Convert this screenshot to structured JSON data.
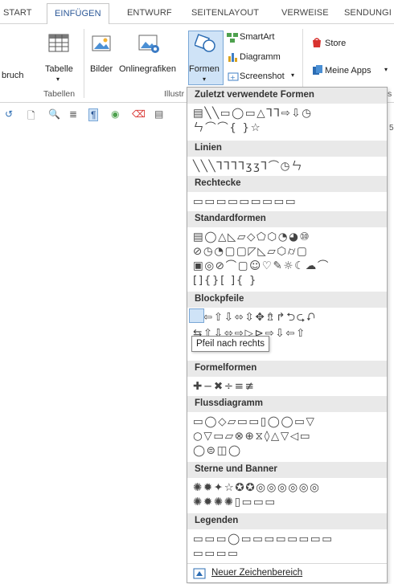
{
  "tabs": [
    "START",
    "EINFÜGEN",
    "ENTWURF",
    "SEITENLAYOUT",
    "VERWEISE",
    "SENDUNGI"
  ],
  "ribbon": {
    "umbruch_fragment": "bruch",
    "tabelle": "Tabelle",
    "bilder": "Bilder",
    "onlinegrafiken": "Onlinegrafiken",
    "formen": "Formen",
    "smartart": "SmartArt",
    "diagramm": "Diagramm",
    "screenshot": "Screenshot",
    "store": "Store",
    "meine_apps": "Meine Apps",
    "group_tabellen": "Tabellen",
    "group_illustrationen_fragment": "Illustr",
    "group_right_fragment": "s",
    "right_edge_fragment": "5"
  },
  "gallery": {
    "sections": [
      {
        "title": "Zuletzt verwendete Formen",
        "rows": [
          "▤╲╲▭◯▭△⅂⅂⇨⇩◷",
          "ㄣ⌒⌒{ }☆"
        ]
      },
      {
        "title": "Linien",
        "rows": [
          "╲╲╲⅂⅂⅂⅂ʒʒ⅂⌒◷ㄣ"
        ]
      },
      {
        "title": "Rechtecke",
        "rows": [
          "▭▭▭▭▭▭▭▭▭"
        ]
      },
      {
        "title": "Standardformen",
        "rows": [
          "▤◯△◺▱◇⬠⬡◔◕⑩",
          "⊘◷◔▢▢◸◺▱⬡⌭▢",
          "▣◎⊘⌒▢☺♡✎☼☾☁⌒",
          "[]{}[ ]{ }"
        ]
      },
      {
        "title": "Blockpfeile",
        "rows": [
          "⇨⇦⇧⇩⬄⇳✥⇯↱⮌⮎⮏",
          "⇆⇧⇩⬄⇨▷⊳⇨⇩⇦⇧"
        ]
      },
      {
        "title": "Formelformen",
        "rows": [
          "✚−✖÷≡≢"
        ]
      },
      {
        "title": "Flussdiagramm",
        "rows": [
          "▭◯◇▱▭▭▯◯◯▭▽",
          "○▽▭▱⊗⊕⧖◊△▽◁▭",
          "◯⊜◫◯"
        ]
      },
      {
        "title": "Sterne und Banner",
        "rows": [
          "✺✹✦☆✪✪◎◎◎◎◎◎",
          "✺✹✺✺▯▭▭▭"
        ]
      },
      {
        "title": "Legenden",
        "rows": [
          "▭▭▭◯▭▭▭▭▭▭▭▭",
          "▭▭▭▭"
        ]
      }
    ],
    "tooltip": "Pfeil nach rechts",
    "footer": "Neuer Zeichenbereich"
  }
}
